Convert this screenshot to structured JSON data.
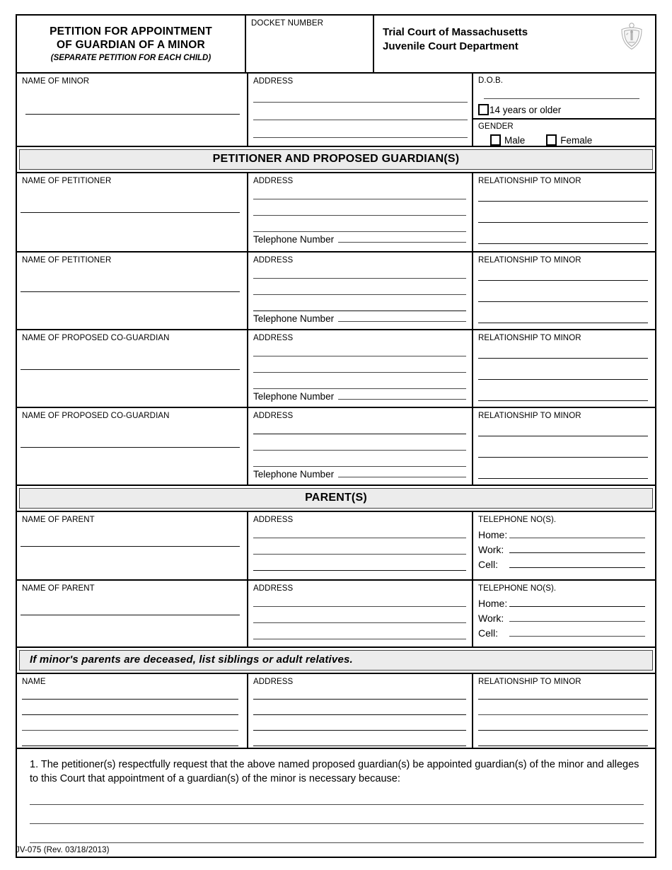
{
  "header": {
    "title_line1": "PETITION FOR APPOINTMENT",
    "title_line2": "OF GUARDIAN OF A MINOR",
    "title_sub": "(SEPARATE PETITION FOR EACH CHILD)",
    "docket_label": "DOCKET NUMBER",
    "docket_value": "",
    "court_line1": "Trial Court of Massachusetts",
    "court_line2": "Juvenile Court Department",
    "seal_name": "massachusetts-state-seal"
  },
  "minor": {
    "name_label": "NAME OF MINOR",
    "name_value": "",
    "address_label": "ADDRESS",
    "address_value": "",
    "dob_label": "D.O.B.",
    "dob_value": "",
    "age_checkbox_label": "14 years or older",
    "age_checked": false,
    "gender_label": "GENDER",
    "gender_male": "Male",
    "gender_female": "Female",
    "male_checked": false,
    "female_checked": false
  },
  "sections": {
    "petitioner_banner": "PETITIONER AND PROPOSED GUARDIAN(S)",
    "parents_banner": "PARENT(S)",
    "siblings_banner": "If minor's parents are deceased, list siblings or adult relatives."
  },
  "labels": {
    "name_of_petitioner": "NAME OF PETITIONER",
    "name_of_coguardian": "NAME OF PROPOSED CO-GUARDIAN",
    "name_of_parent": "NAME OF PARENT",
    "name": "NAME",
    "address": "ADDRESS",
    "relationship": "RELATIONSHIP TO MINOR",
    "telephone_number": "Telephone Number",
    "telephone_nos": "TELEPHONE NO(S).",
    "home": "Home:",
    "work": "Work:",
    "cell": "Cell:"
  },
  "petitioner_rows": [
    {
      "name_label": "NAME OF PETITIONER",
      "name_value": "",
      "address_value": "",
      "telephone_value": "",
      "relationship_value": ""
    },
    {
      "name_label": "NAME OF PETITIONER",
      "name_value": "",
      "address_value": "",
      "telephone_value": "",
      "relationship_value": ""
    },
    {
      "name_label": "NAME OF PROPOSED CO-GUARDIAN",
      "name_value": "",
      "address_value": "",
      "telephone_value": "",
      "relationship_value": ""
    },
    {
      "name_label": "NAME OF PROPOSED CO-GUARDIAN",
      "name_value": "",
      "address_value": "",
      "telephone_value": "",
      "relationship_value": ""
    }
  ],
  "parent_rows": [
    {
      "name_label": "NAME OF PARENT",
      "name_value": "",
      "address_value": "",
      "home_value": "",
      "work_value": "",
      "cell_value": ""
    },
    {
      "name_label": "NAME OF PARENT",
      "name_value": "",
      "address_value": "",
      "home_value": "",
      "work_value": "",
      "cell_value": ""
    }
  ],
  "siblings_row": {
    "name_label": "NAME",
    "address_label": "ADDRESS",
    "relationship_label": "RELATIONSHIP TO MINOR"
  },
  "statement": {
    "text": "1.  The petitioner(s) respectfully request that the above named proposed guardian(s) be appointed guardian(s) of the minor and alleges to this Court that appointment of a guardian(s) of the minor is necessary because:",
    "answer_value": ""
  },
  "footer": {
    "form_id": "JV-075  (Rev. 03/18/2013)"
  },
  "colors": {
    "banner_fill": "#ececec",
    "rule": "#4a4a4a",
    "border": "#000000"
  }
}
